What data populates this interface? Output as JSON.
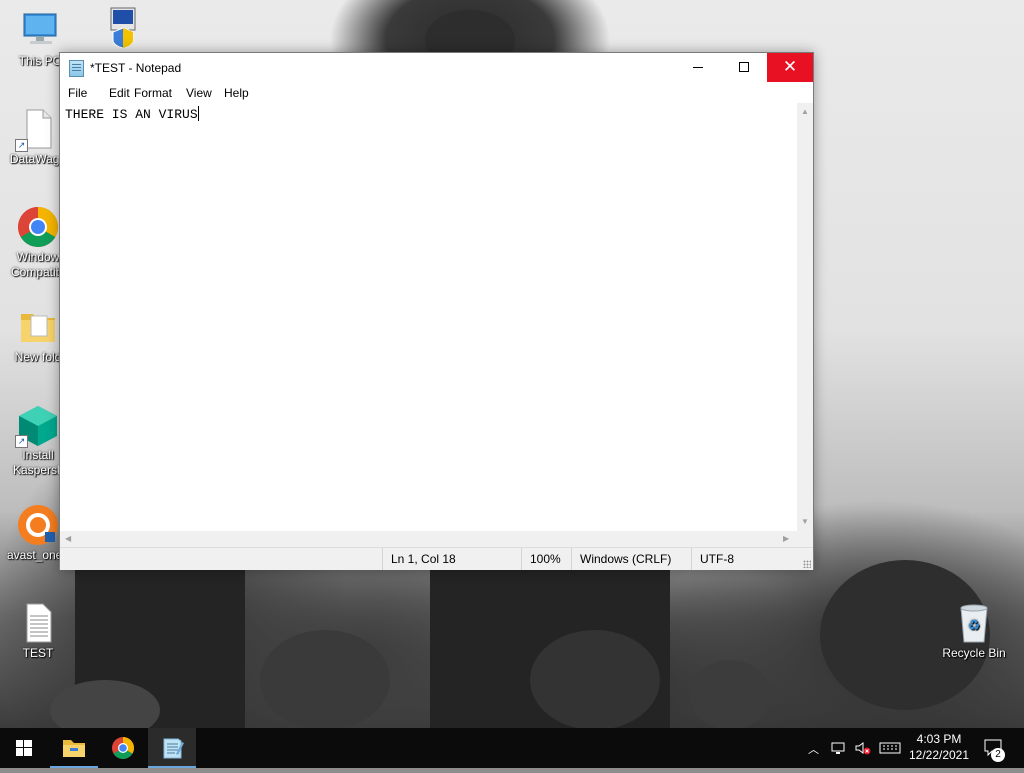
{
  "desktop": {
    "icons": [
      {
        "label": "This PC",
        "icon": "this-pc-icon"
      },
      {
        "label": "",
        "icon": "network-admin-icon"
      },
      {
        "label": "DataWago",
        "icon": "file-shortcut-icon"
      },
      {
        "label": "Window Compatibi",
        "icon": "chrome-icon"
      },
      {
        "label": "New fold",
        "icon": "folder-icon"
      },
      {
        "label": "Install Kaspersk",
        "icon": "kaspersky-icon"
      },
      {
        "label": "avast_one_",
        "icon": "avast-icon"
      },
      {
        "label": "TEST",
        "icon": "text-file-icon"
      },
      {
        "label": "Recycle Bin",
        "icon": "recycle-bin-icon"
      }
    ]
  },
  "notepad": {
    "title": "*TEST - Notepad",
    "menu": [
      "File",
      "Edit",
      "Format",
      "View",
      "Help"
    ],
    "content": "THERE IS AN VIRUS",
    "status": {
      "position": "Ln 1, Col 18",
      "zoom": "100%",
      "line_ending": "Windows (CRLF)",
      "encoding": "UTF-8"
    },
    "buttons": {
      "minimize": "—",
      "maximize": "☐",
      "close": "✕"
    }
  },
  "taskbar": {
    "apps": [
      "start",
      "file-explorer",
      "chrome",
      "notepad"
    ],
    "clock": {
      "time": "4:03 PM",
      "date": "12/22/2021"
    },
    "notification_count": "2"
  }
}
